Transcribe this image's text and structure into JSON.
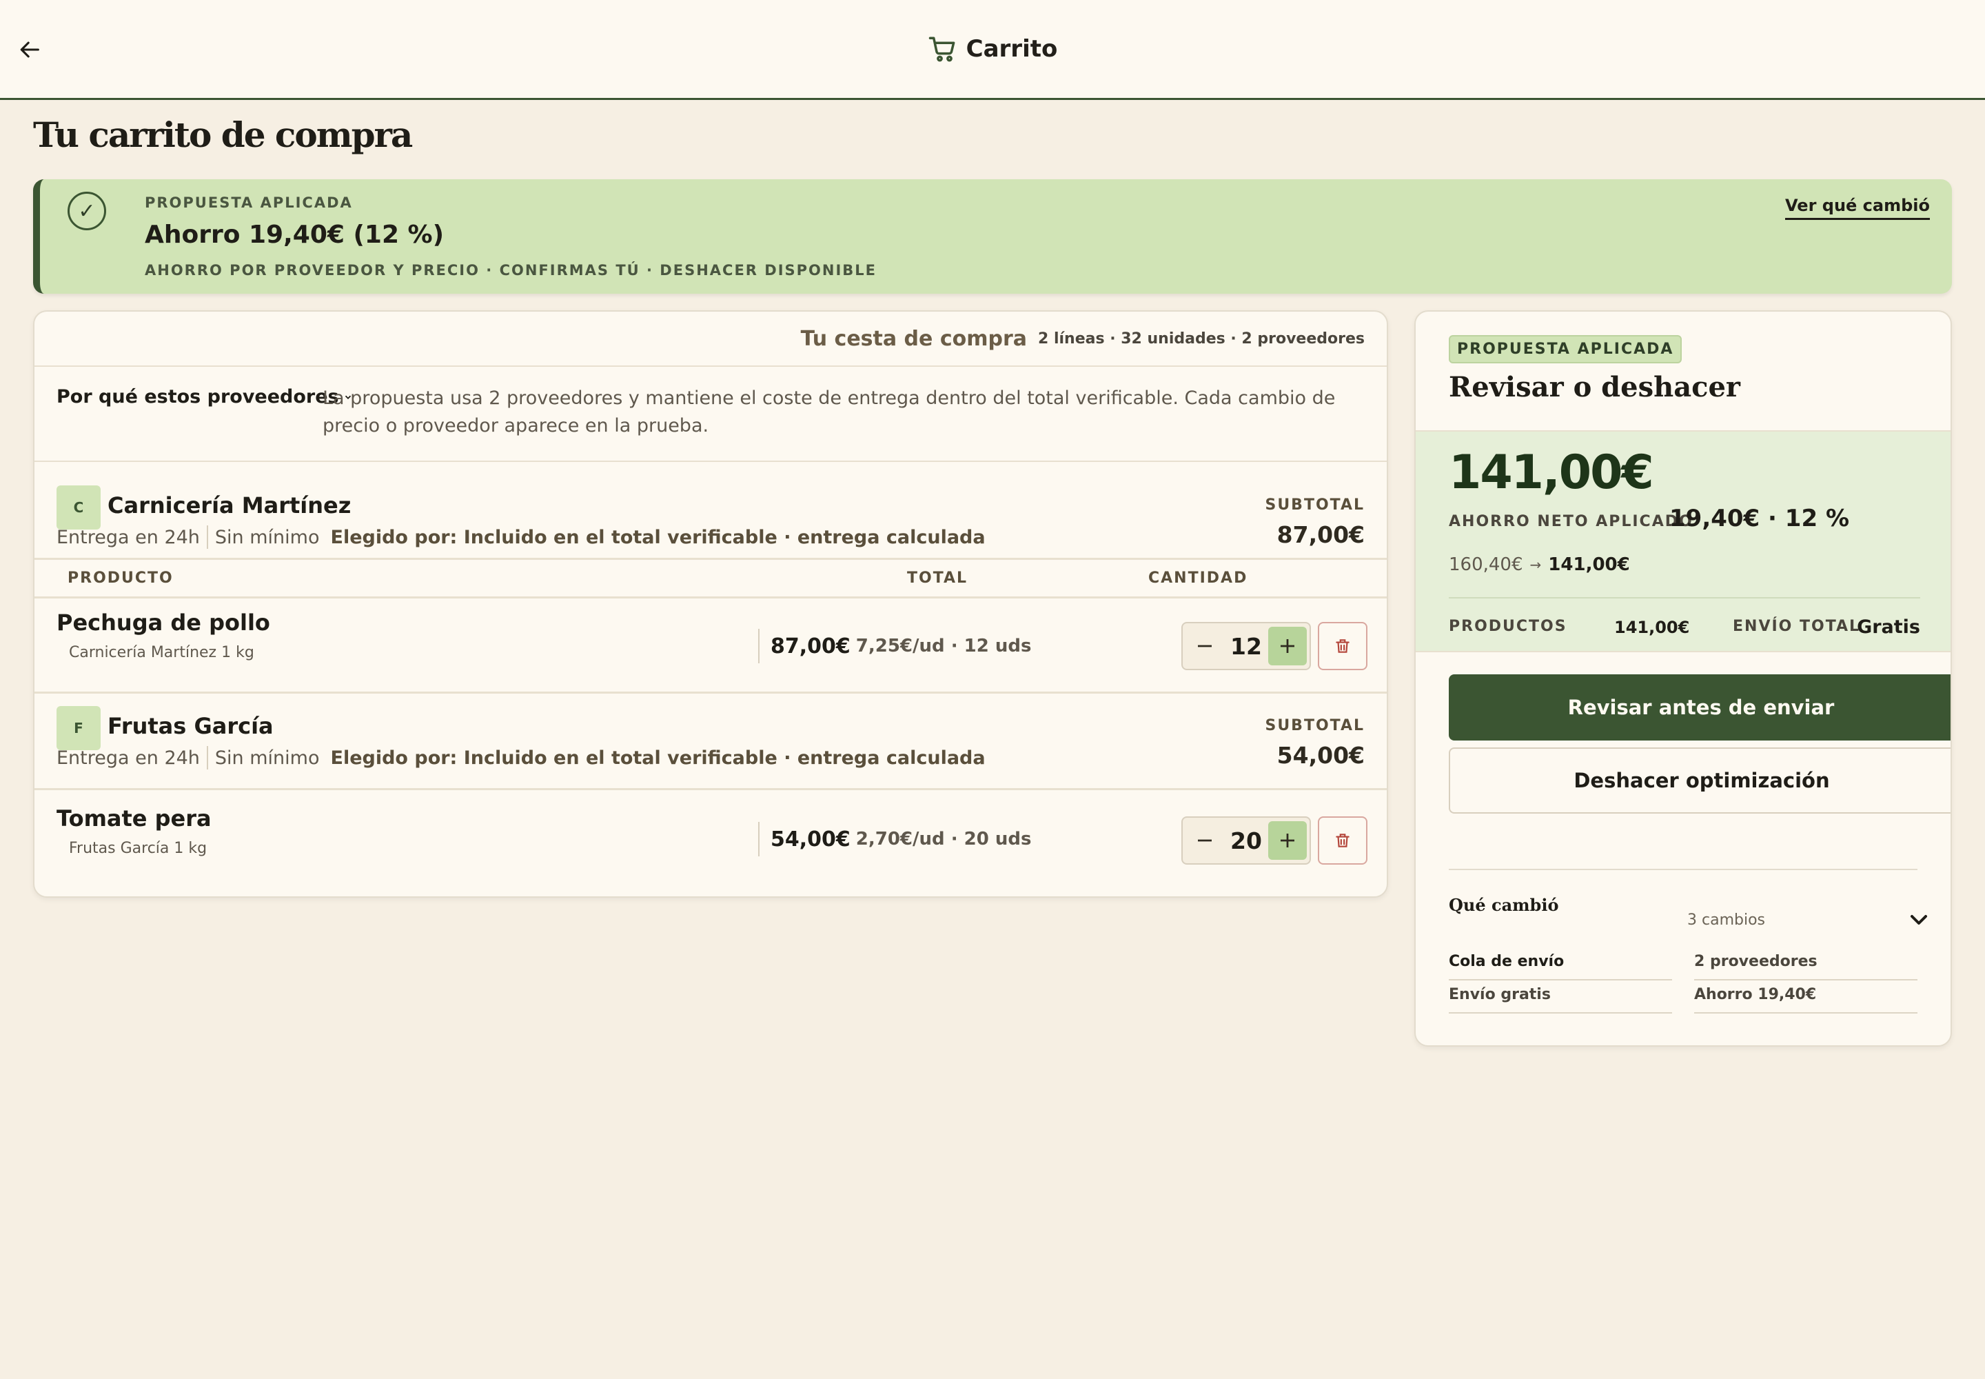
{
  "header": {
    "title": "Carrito"
  },
  "page": {
    "title": "Tu carrito de compra"
  },
  "banner": {
    "eyebrow": "PROPUESTA APLICADA",
    "title": "Ahorro 19,40€ (12 %)",
    "subtitle": "AHORRO POR PROVEEDOR Y PRECIO · CONFIRMAS TÚ · DESHACER DISPONIBLE",
    "link": "Ver qué cambió"
  },
  "cart": {
    "title": "Tu cesta de compra",
    "meta": "2 líneas · 32 unidades · 2 proveedores",
    "why_toggle": "Por qué estos proveedores",
    "why_text": "La propuesta usa 2 proveedores y mantiene el coste de entrega dentro del total verificable. Cada cambio de precio o proveedor aparece en la prueba.",
    "columns": {
      "product": "PRODUCTO",
      "total": "TOTAL",
      "quantity": "CANTIDAD"
    },
    "suppliers": [
      {
        "initial": "C",
        "name": "Carnicería Martínez",
        "delivery": "Entrega en 24h",
        "minimum": "Sin mínimo",
        "chosen": "Elegido por: Incluido en el total verificable · entrega calculada",
        "subtotal_label": "SUBTOTAL",
        "subtotal": "87,00€",
        "product": {
          "name": "Pechuga de pollo",
          "sub": "Carnicería Martínez 1 kg",
          "total": "87,00€",
          "unit": "7,25€/ud · 12 uds",
          "quantity": "12"
        }
      },
      {
        "initial": "F",
        "name": "Frutas García",
        "delivery": "Entrega en 24h",
        "minimum": "Sin mínimo",
        "chosen": "Elegido por: Incluido en el total verificable · entrega calculada",
        "subtotal_label": "SUBTOTAL",
        "subtotal": "54,00€",
        "product": {
          "name": "Tomate pera",
          "sub": "Frutas García 1 kg",
          "total": "54,00€",
          "unit": "2,70€/ud · 20 uds",
          "quantity": "20"
        }
      }
    ]
  },
  "side": {
    "badge": "PROPUESTA APLICADA",
    "title": "Revisar o deshacer",
    "total": "141,00€",
    "net_label": "AHORRO NETO APLICADO",
    "net_value": "19,40€ · 12 %",
    "old_price": "160,40€",
    "arrow": "→",
    "new_price": "141,00€",
    "products_label": "PRODUCTOS",
    "products_value": "141,00€",
    "shipping_label": "ENVÍO TOTAL",
    "shipping_value": "Gratis",
    "primary_button": "Revisar antes de enviar",
    "secondary_button": "Deshacer optimización",
    "changes_title": "Qué cambió",
    "changes_count": "3 cambios",
    "changes": [
      [
        "Cola de envío",
        "2 proveedores"
      ],
      [
        "Envío gratis",
        "Ahorro 19,40€"
      ]
    ]
  },
  "colors": {
    "accent": "#3b5532",
    "accent_light": "#d1e4b6",
    "background": "#f6efe3",
    "card": "#fdf9f1",
    "danger": "#b3453a"
  },
  "icons": {
    "back": "arrow-left-icon",
    "cart": "cart-icon",
    "check": "check-circle-icon",
    "minus": "minus-icon",
    "plus": "plus-icon",
    "trash": "trash-icon",
    "chevron": "chevron-down-icon"
  }
}
